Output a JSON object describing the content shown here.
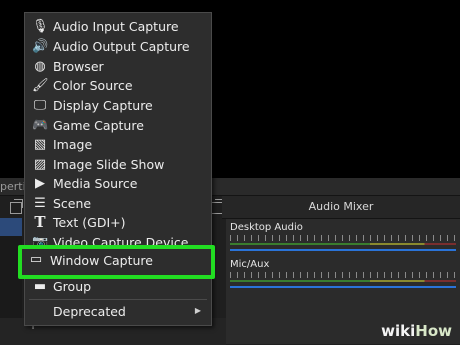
{
  "app": {
    "dock_left_title": "perties",
    "mixer_title": "Audio Mixer",
    "tracks": [
      {
        "label": "Desktop Audio"
      },
      {
        "label": "Mic/Aux"
      }
    ]
  },
  "menu": {
    "items": [
      {
        "label": "Audio Input Capture",
        "icon": "microphone-icon"
      },
      {
        "label": "Audio Output Capture",
        "icon": "speaker-icon"
      },
      {
        "label": "Browser",
        "icon": "globe-icon"
      },
      {
        "label": "Color Source",
        "icon": "paintbrush-icon"
      },
      {
        "label": "Display Capture",
        "icon": "monitor-icon"
      },
      {
        "label": "Game Capture",
        "icon": "gamepad-icon"
      },
      {
        "label": "Image",
        "icon": "image-icon"
      },
      {
        "label": "Image Slide Show",
        "icon": "slideshow-icon"
      },
      {
        "label": "Media Source",
        "icon": "play-icon"
      },
      {
        "label": "Scene",
        "icon": "list-icon"
      },
      {
        "label": "Text (GDI+)",
        "icon": "text-icon"
      },
      {
        "label": "Video Capture Device",
        "icon": "camera-icon"
      },
      {
        "label": "Window Capture",
        "icon": "window-icon"
      },
      {
        "label": "Group",
        "icon": "folder-icon"
      },
      {
        "label": "Deprecated",
        "icon": "chevron-right-icon"
      }
    ],
    "highlighted": "Window Capture"
  },
  "watermark": {
    "part1": "wiki",
    "part2": "How"
  },
  "colors": {
    "highlight": "#22dd22",
    "menu_bg": "#2d2d2d",
    "fader": "#2a73d8"
  }
}
